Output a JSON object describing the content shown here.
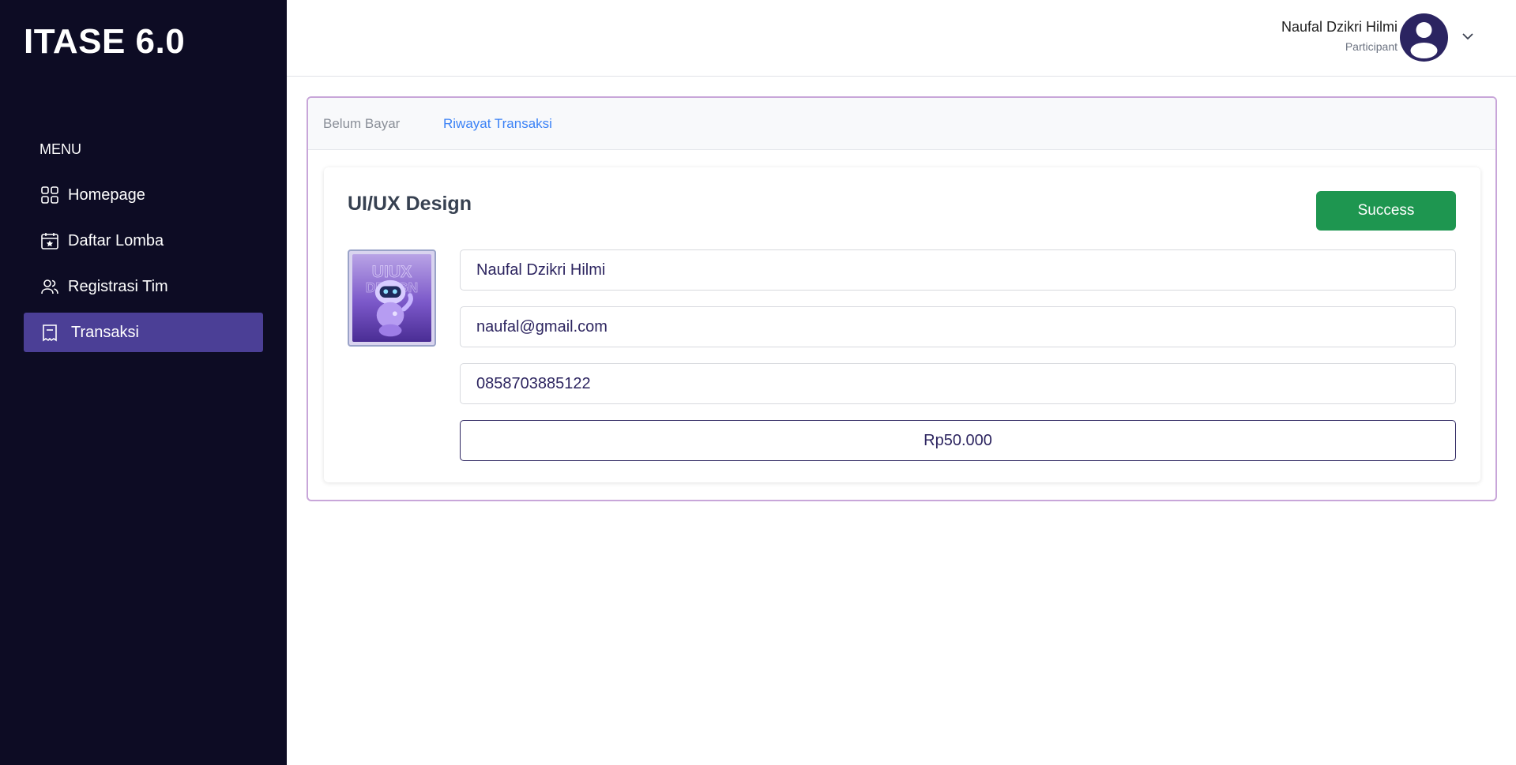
{
  "app": {
    "brand": "ITASE 6.0"
  },
  "sidebar": {
    "heading": "MENU",
    "items": [
      {
        "label": "Homepage",
        "icon": "grid-icon"
      },
      {
        "label": "Daftar Lomba",
        "icon": "calendar-star-icon"
      },
      {
        "label": "Registrasi Tim",
        "icon": "users-icon"
      },
      {
        "label": "Transaksi",
        "icon": "receipt-icon",
        "active": true
      }
    ]
  },
  "header": {
    "user_name": "Naufal Dzikri Hilmi",
    "user_role": "Participant"
  },
  "tabs": {
    "unpaid": "Belum Bayar",
    "history": "Riwayat Transaksi",
    "active": "history"
  },
  "transaction": {
    "title": "UI/UX Design",
    "status": "Success",
    "status_color": "#1e9650",
    "thumbnail_text": "UIUX DESIGN",
    "name": "Naufal Dzikri Hilmi",
    "email": "naufal@gmail.com",
    "phone": "0858703885122",
    "price": "Rp50.000"
  },
  "colors": {
    "sidebar_bg": "#0d0c24",
    "active_item_bg": "#4b3f96",
    "panel_border": "#c8a6d9",
    "tab_active": "#3b82f6"
  }
}
